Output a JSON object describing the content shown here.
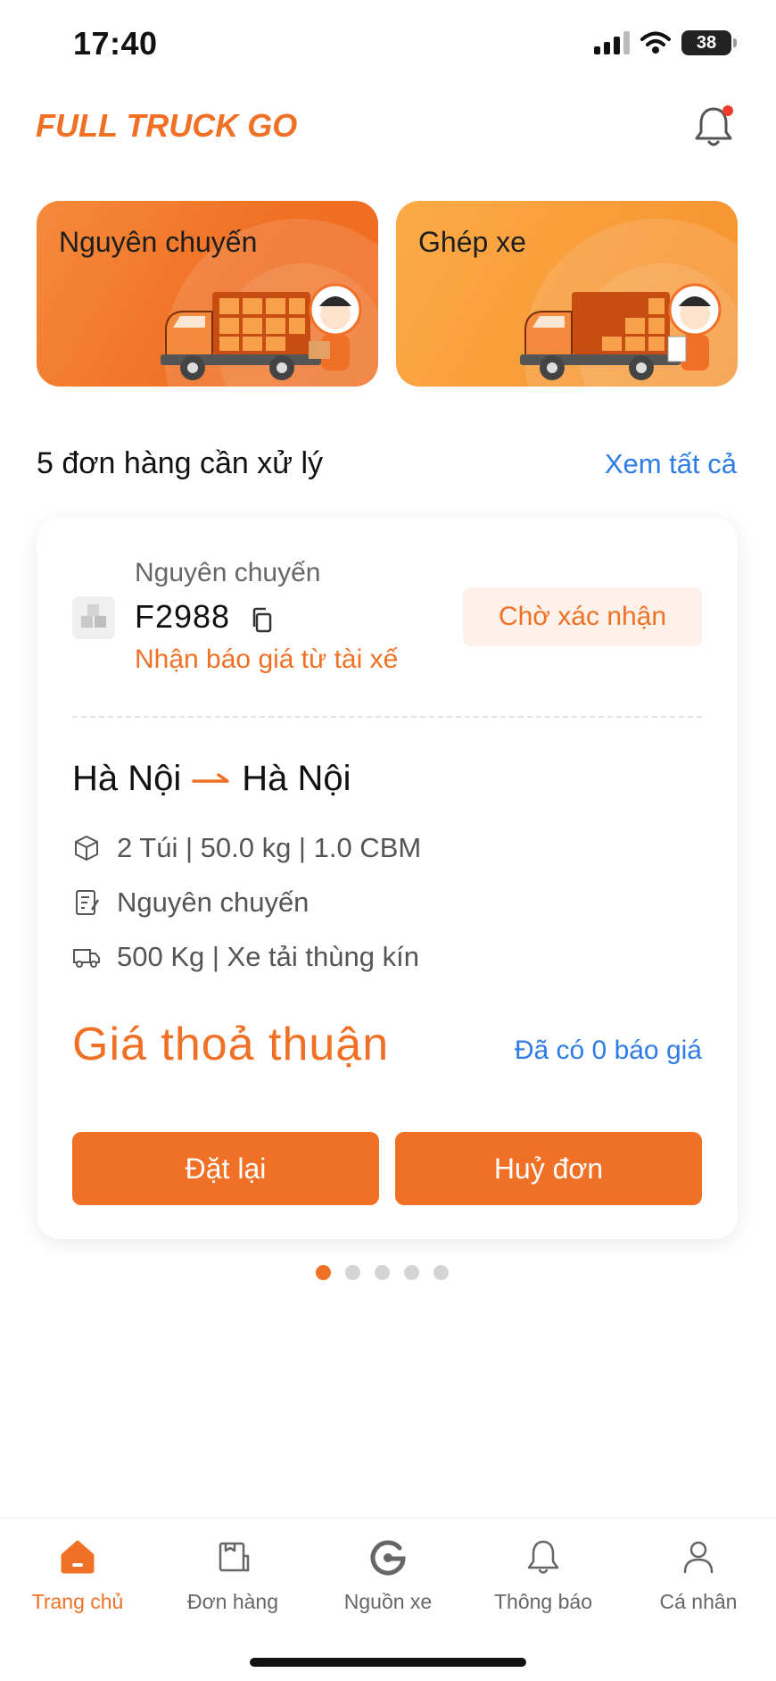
{
  "status_bar": {
    "time": "17:40",
    "battery": "38"
  },
  "header": {
    "logo": "FULL TRUCK GO",
    "bell_icon": "bell-icon"
  },
  "services": [
    {
      "label": "Nguyên chuyến"
    },
    {
      "label": "Ghép xe"
    }
  ],
  "orders_section": {
    "title": "5 đơn hàng cần xử lý",
    "see_all": "Xem tất cả"
  },
  "order": {
    "type": "Nguyên chuyến",
    "id": "F2988",
    "note": "Nhận báo giá từ tài xế",
    "status": "Chờ xác nhận",
    "from": "Hà Nội",
    "to": "Hà Nội",
    "cargo": "2 Túi | 50.0 kg | 1.0 CBM",
    "service": "Nguyên chuyến",
    "vehicle": "500 Kg | Xe tải thùng kín",
    "price": "Giá thoả thuận",
    "quote_count": "Đã có 0 báo giá",
    "reorder_label": "Đặt lại",
    "cancel_label": "Huỷ đơn"
  },
  "pager": {
    "total": 5,
    "active": 1
  },
  "tabs": [
    {
      "label": "Trang chủ",
      "icon": "home-icon",
      "active": true
    },
    {
      "label": "Đơn hàng",
      "icon": "order-icon",
      "active": false
    },
    {
      "label": "Nguồn xe",
      "icon": "truck-source-icon",
      "active": false
    },
    {
      "label": "Thông báo",
      "icon": "bell-icon",
      "active": false
    },
    {
      "label": "Cá nhân",
      "icon": "user-icon",
      "active": false
    }
  ],
  "colors": {
    "accent": "#f07125",
    "link": "#2e7ce8",
    "badge_bg": "#fef1ea"
  }
}
